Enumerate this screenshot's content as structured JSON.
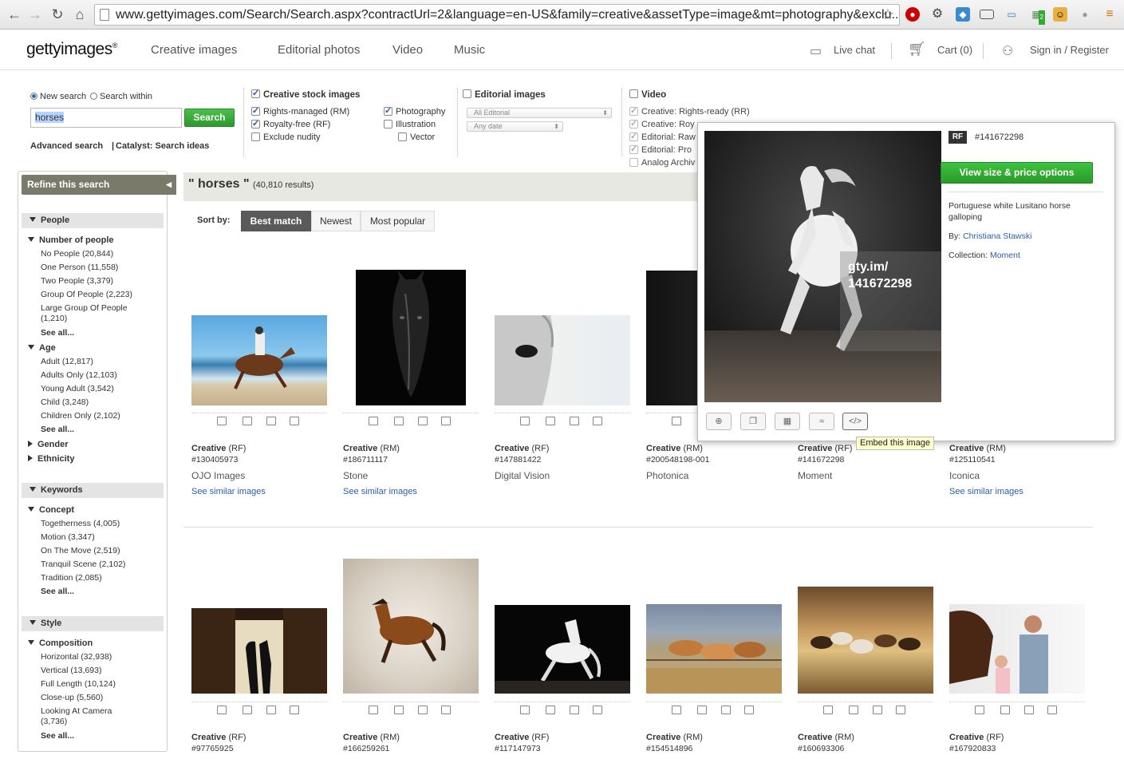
{
  "browser": {
    "url": "www.gettyimages.com/Search/Search.aspx?contractUrl=2&language=en-US&family=creative&assetType=image&mt=photography&exclu...",
    "ext_badge": "2"
  },
  "header": {
    "logo": "gettyimages",
    "logo_mark": "®",
    "nav": [
      "Creative images",
      "Editorial photos",
      "Video",
      "Music"
    ],
    "live_chat": "Live chat",
    "cart": "Cart (0)",
    "sign_in": "Sign in / Register"
  },
  "search": {
    "new_search": "New search",
    "search_within": "Search within",
    "query": "horses",
    "button": "Search",
    "advanced": "Advanced search",
    "catalyst": "Catalyst: Search ideas",
    "creative": {
      "title": "Creative stock images",
      "rm": "Rights-managed (RM)",
      "rf": "Royalty-free (RF)",
      "nudity": "Exclude nudity",
      "photography": "Photography",
      "illustration": "Illustration",
      "vector": "Vector"
    },
    "editorial": {
      "title": "Editorial images",
      "select1": "All Editorial",
      "select2": "Any date"
    },
    "video": {
      "title": "Video",
      "items": [
        "Creative:  Rights-ready (RR)",
        "Creative:  Roy",
        "Editorial:  Raw",
        "Editorial:  Pro",
        "Analog Archiv"
      ]
    }
  },
  "sidebar": {
    "refine": "Refine this search",
    "people": "People",
    "number_of_people": "Number of people",
    "people_items": [
      "No People (20,844)",
      "One Person (11,558)",
      "Two People (3,379)",
      "Group Of People (2,223)",
      "Large Group Of People (1,210)"
    ],
    "see_all": "See all...",
    "age": "Age",
    "age_items": [
      "Adult (12,817)",
      "Adults Only (12,103)",
      "Young Adult (3,542)",
      "Child (3,248)",
      "Children Only (2,102)"
    ],
    "gender": "Gender",
    "ethnicity": "Ethnicity",
    "keywords": "Keywords",
    "concept": "Concept",
    "concept_items": [
      "Togetherness (4,005)",
      "Motion (3,347)",
      "On The Move (2,519)",
      "Tranquil Scene (2,102)",
      "Tradition (2,085)"
    ],
    "style": "Style",
    "composition": "Composition",
    "composition_items": [
      "Horizontal (32,938)",
      "Vertical (13,693)",
      "Full Length (10,124)",
      "Close-up (5,560)",
      "Looking At Camera (3,736)"
    ]
  },
  "results": {
    "title": "\" horses \"",
    "count": "(40,810 results)",
    "sort_label": "Sort by:",
    "sort": [
      "Best match",
      "Newest",
      "Most popular"
    ],
    "similar": "See similar images",
    "row1": [
      {
        "type": "Creative",
        "lic": "(RF)",
        "id": "#130405973",
        "coll": "OJO Images"
      },
      {
        "type": "Creative",
        "lic": "(RM)",
        "id": "#186711117",
        "coll": "Stone"
      },
      {
        "type": "Creative",
        "lic": "(RF)",
        "id": "#147881422",
        "coll": "Digital Vision"
      },
      {
        "type": "Creative",
        "lic": "(RM)",
        "id": "#200548198-001",
        "coll": "Photonica"
      },
      {
        "type": "Creative",
        "lic": "(RF)",
        "id": "#141672298",
        "coll": "Moment"
      },
      {
        "type": "Creative",
        "lic": "(RM)",
        "id": "#125110541",
        "coll": "Iconica"
      }
    ],
    "row2": [
      {
        "type": "Creative",
        "lic": "(RF)",
        "id": "#97765925"
      },
      {
        "type": "Creative",
        "lic": "(RM)",
        "id": "#166259261"
      },
      {
        "type": "Creative",
        "lic": "(RF)",
        "id": "#117147973"
      },
      {
        "type": "Creative",
        "lic": "(RM)",
        "id": "#154514896"
      },
      {
        "type": "Creative",
        "lic": "(RM)",
        "id": "#160693306"
      },
      {
        "type": "Creative",
        "lic": "(RF)",
        "id": "#167920833"
      }
    ]
  },
  "popup": {
    "badge": "RF",
    "id": "#141672298",
    "button": "View size & price options",
    "desc": "Portuguese white Lusitano horse galloping",
    "by_label": "By:",
    "by": "Christiana Stawski",
    "coll_label": "Collection:",
    "coll": "Moment",
    "watermark": "gty.im/ 141672298",
    "embed_icon": "</>",
    "tooltip": "Embed this image"
  },
  "icons": [
    "back-arrow-icon",
    "forward-arrow-icon",
    "reload-icon",
    "home-icon",
    "star-icon",
    "chat-icon",
    "cart-icon",
    "user-icon",
    "add-to-cart-icon",
    "lightbox-icon",
    "calculator-icon",
    "similar-icon",
    "embed-icon"
  ],
  "colors": {
    "accent_green": "#2c9a2c",
    "link_blue": "#2a5db0",
    "sort_active": "#5a5a5a"
  }
}
